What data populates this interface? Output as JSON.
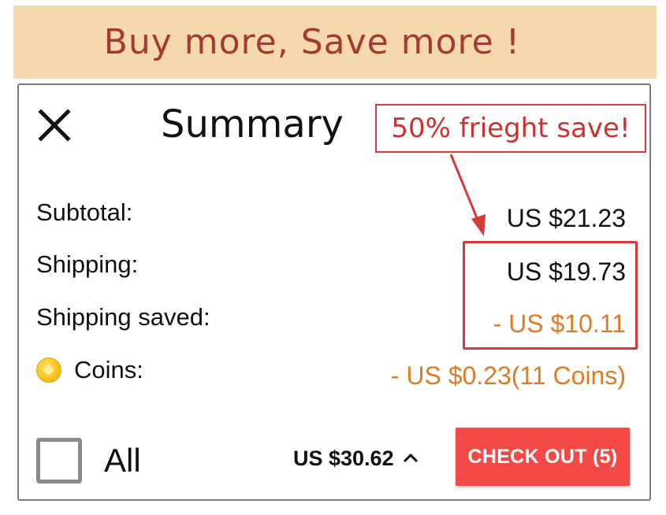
{
  "banner": {
    "text": "Buy more, Save more !"
  },
  "summary": {
    "title": "Summary",
    "close_icon": "close-icon",
    "promo_callout": "50% frieght save!",
    "rows": {
      "subtotal": {
        "label": "Subtotal:",
        "value": "US $21.23"
      },
      "shipping": {
        "label": "Shipping:",
        "value": "US $19.73"
      },
      "shipping_saved": {
        "label": "Shipping  saved:",
        "value": "- US $10.11"
      },
      "coins": {
        "label": "Coins:",
        "value": "- US $0.23(11 Coins)",
        "icon": "coin-icon"
      }
    }
  },
  "footer": {
    "select_all_label": "All",
    "select_all_checked": false,
    "total": "US $30.62",
    "expand_icon": "chevron-up-icon",
    "checkout_label": "CHECK OUT (5)"
  },
  "colors": {
    "banner_bg": "#f5d9ad",
    "banner_text": "#a23a35",
    "accent_red": "#d63a3a",
    "discount_orange": "#e07a23",
    "checkout_bg": "#f44a47"
  }
}
